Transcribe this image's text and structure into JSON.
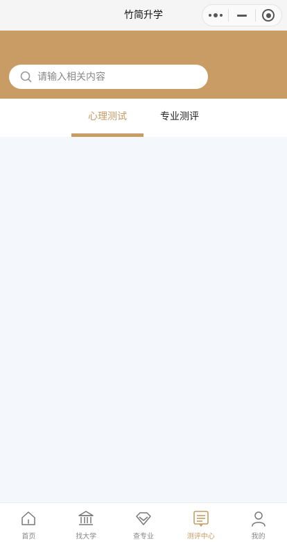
{
  "navbar": {
    "title": "竹简升学"
  },
  "search": {
    "placeholder": "请输入相关内容"
  },
  "tabs": [
    {
      "label": "心理测试",
      "active": true
    },
    {
      "label": "专业测评",
      "active": false
    }
  ],
  "tabbar": [
    {
      "label": "首页",
      "icon": "home-icon"
    },
    {
      "label": "找大学",
      "icon": "university-icon"
    },
    {
      "label": "查专业",
      "icon": "diamond-icon"
    },
    {
      "label": "测评中心",
      "icon": "assessment-icon",
      "active": true
    },
    {
      "label": "我的",
      "icon": "user-icon"
    }
  ],
  "colors": {
    "accent": "#c89c64",
    "background": "#f4f7fb"
  }
}
